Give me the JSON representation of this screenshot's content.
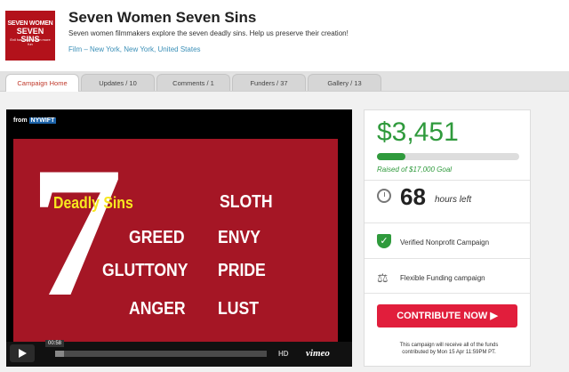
{
  "header": {
    "logo": {
      "line1": "SEVEN WOMEN",
      "line2": "SEVEN SINS",
      "line3": "Evil has never been more fun"
    },
    "title": "Seven Women Seven Sins",
    "subtitle": "Seven women filmmakers explore the seven deadly sins. Help us preserve their creation!",
    "category": "Film – New York, New York, United States"
  },
  "tabs": [
    {
      "label": "Campaign Home",
      "active": true
    },
    {
      "label": "Updates / 10"
    },
    {
      "label": "Comments / 1"
    },
    {
      "label": "Funders / 37"
    },
    {
      "label": "Gallery / 13"
    }
  ],
  "video": {
    "from_label": "from",
    "from_org": "NYWIFT",
    "seven": "7",
    "deadly": "Deadly Sins",
    "sins": [
      "SLOTH",
      "GREED",
      "ENVY",
      "GLUTTONY",
      "PRIDE",
      "ANGER",
      "LUST"
    ],
    "time": "00:58",
    "progress": 0.04,
    "hd": "HD",
    "brand": "vimeo"
  },
  "campaign": {
    "raised": "$3,451",
    "goal_text": "Raised of $17,000 Goal",
    "progress": 0.203,
    "hours": "68",
    "hours_label": "hours left",
    "verified": "Verified Nonprofit Campaign",
    "funding": "Flexible Funding campaign",
    "contribute": "CONTRIBUTE NOW ▶",
    "fine_print": "This campaign will receive all of the funds contributed by Mon 15 Apr 11:59PM PT.",
    "accent": "#2f9a3c",
    "button_color": "#e11e3c"
  }
}
